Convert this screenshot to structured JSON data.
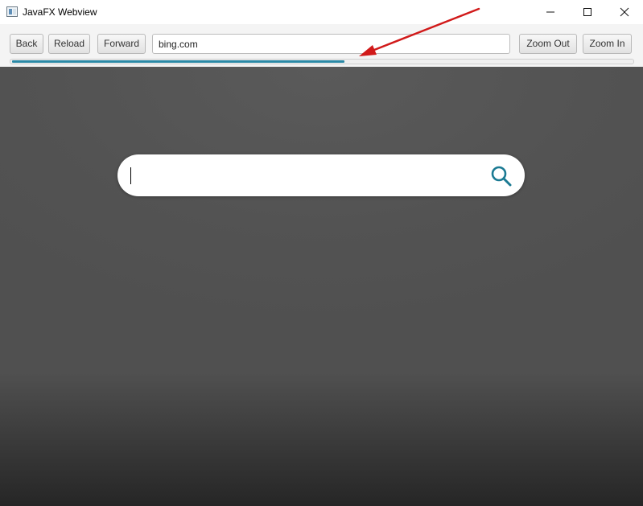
{
  "window": {
    "title": "JavaFX Webview",
    "app_icon": "window-app-icon",
    "controls": [
      "minimize-icon",
      "maximize-icon",
      "close-icon"
    ]
  },
  "toolbar": {
    "back_label": "Back",
    "reload_label": "Reload",
    "forward_label": "Forward",
    "url_value": "bing.com",
    "zoom_out_label": "Zoom Out",
    "zoom_in_label": "Zoom In"
  },
  "progress": {
    "fraction": 0.535,
    "color": "#2b89a6"
  },
  "page": {
    "search_value": "",
    "search_icon": "search-icon",
    "accent_color": "#1b7a93"
  },
  "annotation": {
    "color": "#d11a1a",
    "points_to": "progress-bar"
  }
}
